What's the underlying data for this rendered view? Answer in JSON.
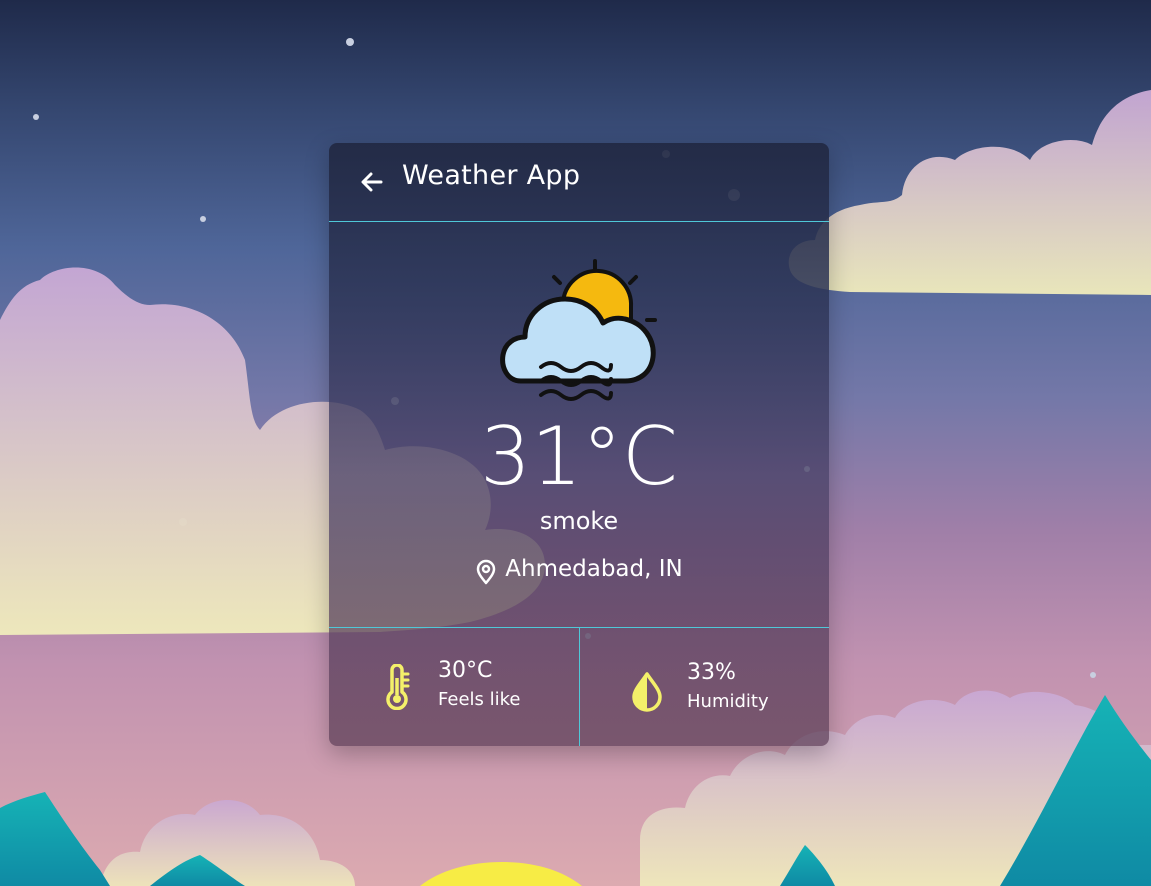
{
  "app": {
    "title": "Weather App",
    "back_icon": "arrow-left-icon"
  },
  "weather": {
    "temperature": "31°C",
    "condition": "smoke",
    "location": "Ahmedabad, IN",
    "condition_icon": "cloud-sun-fog-icon",
    "location_icon": "map-pin-icon"
  },
  "stats": {
    "feels_like": {
      "value": "30°C",
      "label": "Feels like",
      "icon": "thermometer-icon"
    },
    "humidity": {
      "value": "33%",
      "label": "Humidity",
      "icon": "water-drop-icon"
    }
  },
  "colors": {
    "accent_line": "#4fc8d8",
    "stat_icon": "#f4f06a",
    "sun": "#f5b90f",
    "cloud": "#bfe0f7"
  }
}
